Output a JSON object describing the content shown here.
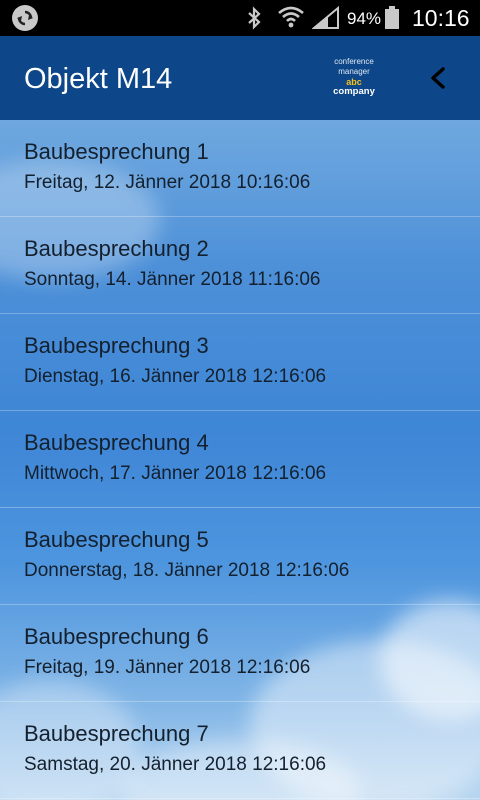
{
  "status_bar": {
    "battery_percent": "94%",
    "time": "10:16",
    "icons": [
      "sync-icon",
      "bluetooth-icon",
      "wifi-icon",
      "cell-signal-icon",
      "battery-icon"
    ]
  },
  "header": {
    "title": "Objekt M14",
    "logo": {
      "line1": "conference",
      "line2": "manager",
      "line3": "abc",
      "line4": "company"
    },
    "colors": {
      "background": "#0d4789",
      "logo_accent": "#f2c11a"
    }
  },
  "meetings": [
    {
      "name": "Baubesprechung 1",
      "date": "Freitag, 12. Jänner 2018 10:16:06"
    },
    {
      "name": "Baubesprechung 2",
      "date": "Sonntag, 14. Jänner 2018 11:16:06"
    },
    {
      "name": "Baubesprechung 3",
      "date": "Dienstag, 16. Jänner 2018 12:16:06"
    },
    {
      "name": "Baubesprechung 4",
      "date": "Mittwoch, 17. Jänner 2018 12:16:06"
    },
    {
      "name": "Baubesprechung 5",
      "date": "Donnerstag, 18. Jänner 2018 12:16:06"
    },
    {
      "name": "Baubesprechung 6",
      "date": "Freitag, 19. Jänner 2018 12:16:06"
    },
    {
      "name": "Baubesprechung 7",
      "date": "Samstag, 20. Jänner 2018 12:16:06"
    }
  ]
}
